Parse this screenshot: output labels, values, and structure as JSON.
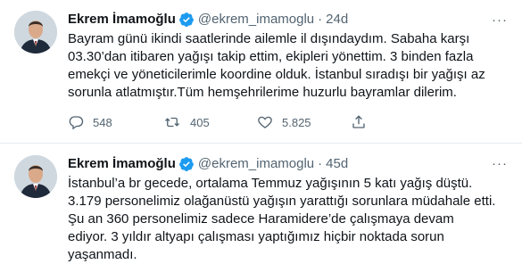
{
  "tweets": [
    {
      "name": "Ekrem İmamoğlu",
      "handle": "@ekrem_imamoglu",
      "separator": "·",
      "time": "24d",
      "more": "···",
      "text": "Bayram günü ikindi saatlerinde ailemle il dışındaydım. Sabaha karşı 03.30’dan itibaren yağışı takip ettim, ekipleri yönettim. 3 binden fazla emekçi ve yöneticilerimle koordine olduk. İstanbul sıradışı bir yağışı az sorunla atlatmıştır.Tüm hemşehrilerime huzurlu bayramlar dilerim.",
      "replies": "548",
      "retweets": "405",
      "likes": "5.825"
    },
    {
      "name": "Ekrem İmamoğlu",
      "handle": "@ekrem_imamoglu",
      "separator": "·",
      "time": "45d",
      "more": "···",
      "text": "İstanbul’a br gecede, ortalama Temmuz yağışının 5 katı yağış düştü. 3.179 personelimiz olağanüstü yağışın yarattığı sorunlara müdahale etti. Şu an 360 personelimiz sadece Haramidere’de çalışmaya devam ediyor. 3 yıldır altyapı çalışması yaptığımız hiçbir noktada sorun yaşanmadı."
    }
  ],
  "colors": {
    "verified": "#1d9bf0",
    "muted": "#536471",
    "text": "#0f1419",
    "divider": "#e6ecf0"
  },
  "icons": {
    "verified": "verified-badge-icon",
    "reply": "reply-icon",
    "retweet": "retweet-icon",
    "like": "heart-icon",
    "share": "share-icon"
  }
}
